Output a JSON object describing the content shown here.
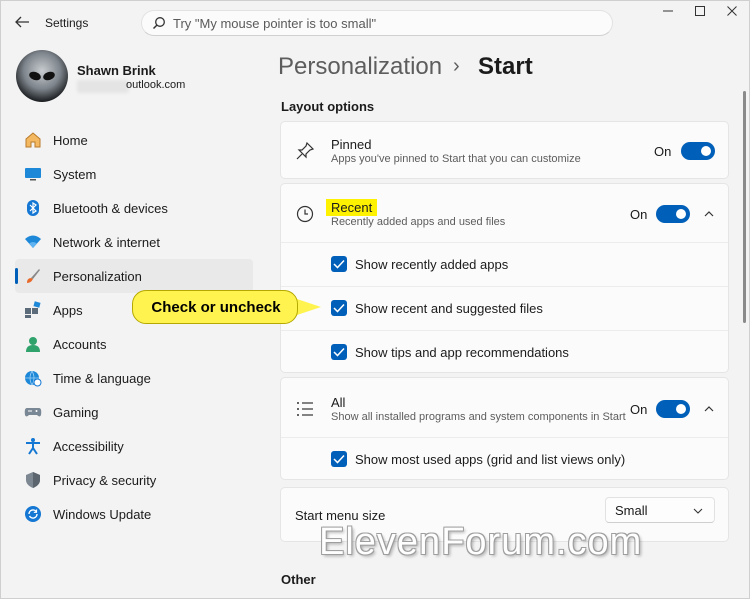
{
  "app": {
    "title": "Settings"
  },
  "search": {
    "placeholder": "Try \"My mouse pointer is too small\""
  },
  "profile": {
    "name": "Shawn Brink",
    "email": "outlook.com"
  },
  "sidebar": {
    "items": [
      {
        "label": "Home",
        "icon": "home-icon"
      },
      {
        "label": "System",
        "icon": "monitor-icon"
      },
      {
        "label": "Bluetooth & devices",
        "icon": "bluetooth-icon"
      },
      {
        "label": "Network & internet",
        "icon": "wifi-icon"
      },
      {
        "label": "Personalization",
        "icon": "brush-icon",
        "selected": true
      },
      {
        "label": "Apps",
        "icon": "apps-icon"
      },
      {
        "label": "Accounts",
        "icon": "accounts-icon"
      },
      {
        "label": "Time & language",
        "icon": "globe-clock-icon"
      },
      {
        "label": "Gaming",
        "icon": "gamepad-icon"
      },
      {
        "label": "Accessibility",
        "icon": "accessibility-icon"
      },
      {
        "label": "Privacy & security",
        "icon": "shield-icon"
      },
      {
        "label": "Windows Update",
        "icon": "update-icon"
      }
    ]
  },
  "breadcrumb": {
    "parent": "Personalization",
    "separator": "›",
    "current": "Start"
  },
  "layout_options": {
    "title": "Layout options",
    "pinned": {
      "title": "Pinned",
      "desc": "Apps you've pinned to Start that you can customize",
      "state": "On"
    },
    "recent": {
      "title": "Recent",
      "desc": "Recently added apps and used files",
      "state": "On",
      "options": [
        "Show recently added apps",
        "Show recent and suggested files",
        "Show tips and app recommendations"
      ]
    },
    "all": {
      "title": "All",
      "desc": "Show all installed programs and system components in Start",
      "state": "On",
      "options": [
        "Show most used apps (grid and list views only)"
      ]
    },
    "menu_size": {
      "label": "Start menu size",
      "value": "Small"
    }
  },
  "other": {
    "title": "Other"
  },
  "callout": {
    "text": "Check or uncheck"
  },
  "watermark": {
    "text": "ElevenForum.com"
  },
  "colors": {
    "accent": "#005fb8",
    "callout": "#fff44f",
    "highlight": "#fff200"
  }
}
